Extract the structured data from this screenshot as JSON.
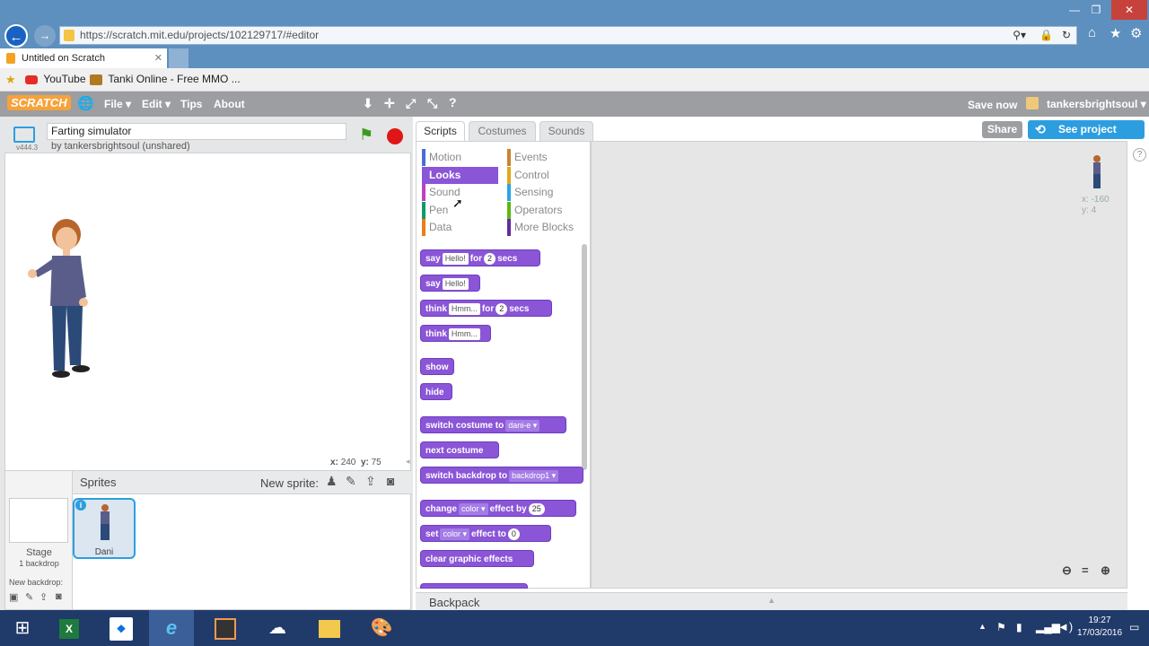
{
  "browser": {
    "url": "https://scratch.mit.edu/projects/102129717/#editor",
    "tab_title": "Untitled on Scratch",
    "favorites": [
      {
        "label": "YouTube",
        "icon": "youtube-icon"
      },
      {
        "label": "Tanki Online - Free MMO ...",
        "icon": "tanki-icon"
      }
    ]
  },
  "menubar": {
    "logo": "SCRATCH",
    "file": "File",
    "edit": "Edit",
    "tips": "Tips",
    "about": "About",
    "save_now": "Save now",
    "username": "tankersbrightsoul"
  },
  "project": {
    "version": "v444.3",
    "title": "Farting simulator",
    "author": "by tankersbrightsoul (unshared)",
    "coords": {
      "x_label": "x:",
      "x": "240",
      "y_label": "y:",
      "y": "75"
    }
  },
  "editor_tabs": [
    "Scripts",
    "Costumes",
    "Sounds"
  ],
  "actions": {
    "share": "Share",
    "see_project": "See project page"
  },
  "categories": [
    {
      "label": "Motion",
      "color": "#4a6cd4",
      "active": false
    },
    {
      "label": "Events",
      "color": "#c88330",
      "active": false
    },
    {
      "label": "Looks",
      "color": "#8a55d7",
      "active": true
    },
    {
      "label": "Control",
      "color": "#e1a91a",
      "active": false
    },
    {
      "label": "Sound",
      "color": "#bb42c3",
      "active": false
    },
    {
      "label": "Sensing",
      "color": "#2ca5e2",
      "active": false
    },
    {
      "label": "Pen",
      "color": "#0e9a6c",
      "active": false
    },
    {
      "label": "Operators",
      "color": "#5cb712",
      "active": false
    },
    {
      "label": "Data",
      "color": "#ee7d16",
      "active": false
    },
    {
      "label": "More Blocks",
      "color": "#632d99",
      "active": false
    }
  ],
  "blocks": {
    "say_for": {
      "a": "say",
      "slot": "Hello!",
      "b": "for",
      "num": "2",
      "c": "secs"
    },
    "say": {
      "a": "say",
      "slot": "Hello!"
    },
    "think_for": {
      "a": "think",
      "slot": "Hmm...",
      "b": "for",
      "num": "2",
      "c": "secs"
    },
    "think": {
      "a": "think",
      "slot": "Hmm..."
    },
    "show": "show",
    "hide": "hide",
    "switch_costume": {
      "a": "switch costume to",
      "drop": "dani-e"
    },
    "next_costume": "next costume",
    "switch_backdrop": {
      "a": "switch backdrop to",
      "drop": "backdrop1"
    },
    "change_effect": {
      "a": "change",
      "drop": "color",
      "b": "effect by",
      "num": "25"
    },
    "set_effect": {
      "a": "set",
      "drop": "color",
      "b": "effect to",
      "num": "0"
    },
    "clear_effects": "clear graphic effects"
  },
  "sprite_info": {
    "x_label": "x:",
    "x": "-160",
    "y_label": "y:",
    "y": "4"
  },
  "sprites_pane": {
    "title": "Sprites",
    "new_sprite": "New sprite:",
    "stage_label": "Stage",
    "stage_sub": "1 backdrop",
    "new_backdrop": "New backdrop:",
    "sprite_name": "Dani"
  },
  "backpack": "Backpack",
  "clock": {
    "time": "19:27",
    "date": "17/03/2016"
  }
}
